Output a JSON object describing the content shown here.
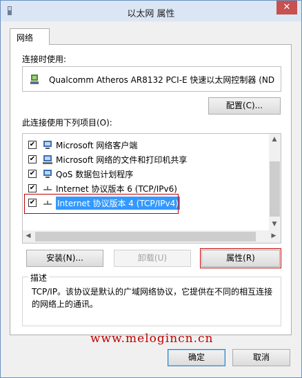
{
  "window": {
    "title": "以太网 属性",
    "close_label": "✕"
  },
  "tabs": [
    {
      "label": "网络"
    }
  ],
  "connect_using": {
    "label": "连接时使用:",
    "adapter_name": "Qualcomm Atheros AR8132 PCI-E 快速以太网控制器 (ND",
    "configure_label": "配置(C)..."
  },
  "items_section": {
    "label": "此连接使用下列项目(O):",
    "items": [
      {
        "label": "Microsoft 网络客户端",
        "checked": true,
        "icon": "network-client-icon"
      },
      {
        "label": "Microsoft 网络的文件和打印机共享",
        "checked": true,
        "icon": "file-printer-sharing-icon"
      },
      {
        "label": "QoS 数据包计划程序",
        "checked": true,
        "icon": "qos-scheduler-icon"
      },
      {
        "label": "Internet 协议版本 6 (TCP/IPv6)",
        "checked": true,
        "icon": "protocol-icon"
      },
      {
        "label": "Internet 协议版本 4 (TCP/IPv4)",
        "checked": true,
        "icon": "protocol-icon",
        "selected": true
      }
    ]
  },
  "actions": {
    "install_label": "安装(N)...",
    "uninstall_label": "卸载(U)",
    "properties_label": "属性(R)"
  },
  "description": {
    "title": "描述",
    "text": "TCP/IP。该协议是默认的广域网络协议，它提供在不同的相互连接的网络上的通讯。"
  },
  "watermark": "www.melogincn.cn",
  "footer": {
    "ok_label": "确定",
    "cancel_label": "取消"
  },
  "colors": {
    "selection": "#3399ff",
    "highlight_frame": "#c00000",
    "close_button": "#c75050"
  }
}
